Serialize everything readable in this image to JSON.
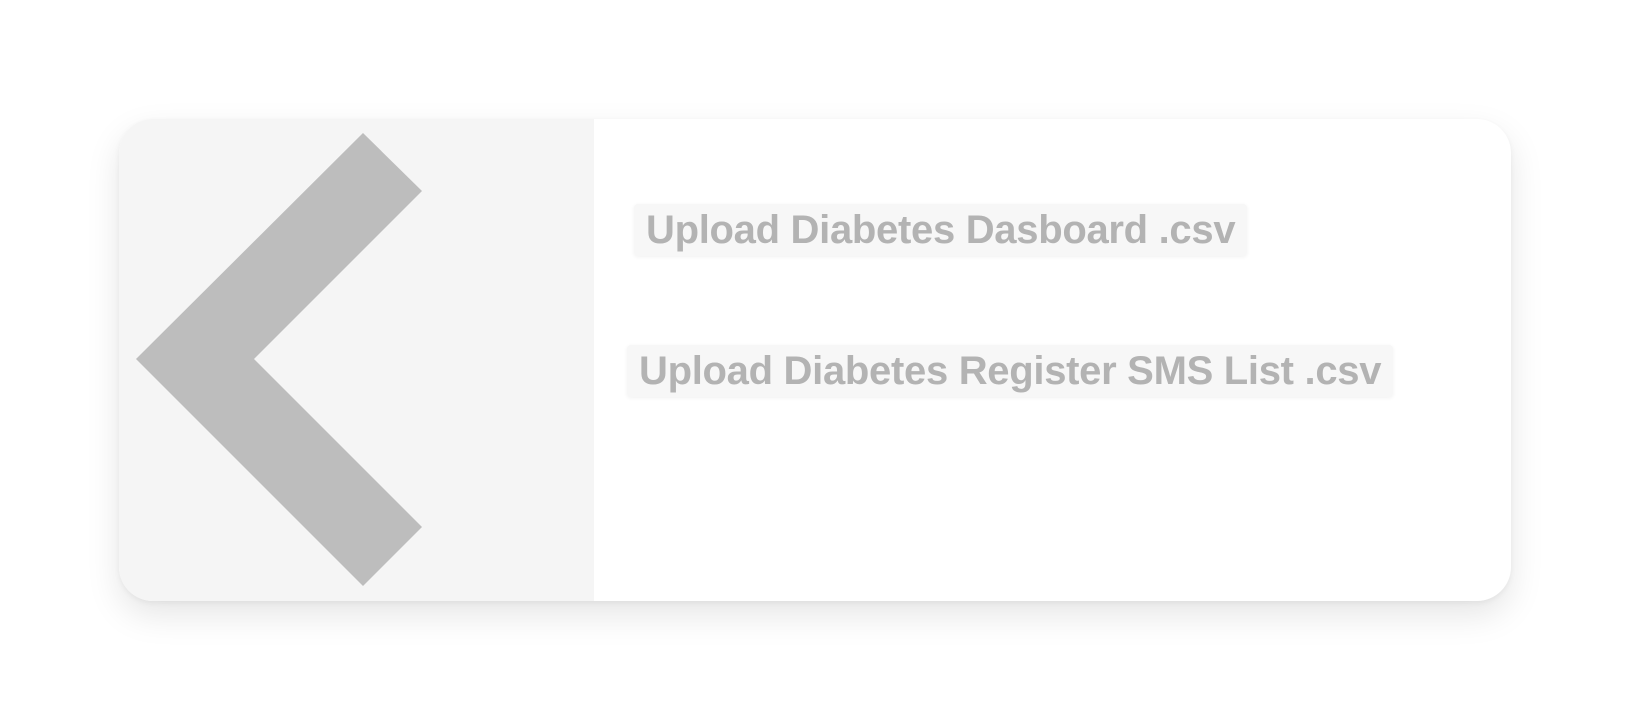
{
  "back": {
    "icon": "chevron-left-icon",
    "color": "#bdbdbd",
    "panel_color": "#f5f5f5"
  },
  "uploads": {
    "dashboard_label": "Upload Diabetes Dasboard .csv",
    "sms_list_label": "Upload Diabetes Register SMS List .csv"
  },
  "colors": {
    "button_text": "#b3b3b3",
    "button_bg": "#f7f7f7"
  }
}
